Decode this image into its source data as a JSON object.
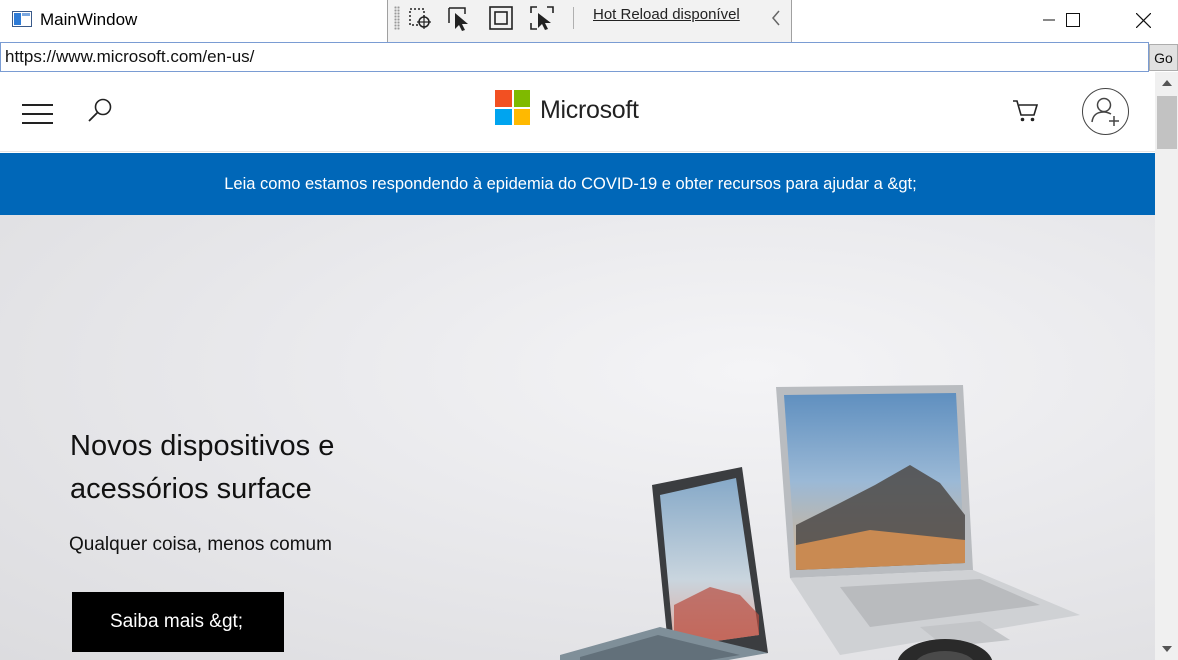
{
  "window": {
    "title": "MainWindow",
    "icon": "app-window-icon",
    "controls": [
      "minimize-icon",
      "maximize-icon",
      "close-icon"
    ]
  },
  "hot_reload_toolbar": {
    "tools": [
      "select-element-icon",
      "pointer-icon",
      "layout-adorner-icon",
      "track-focus-icon"
    ],
    "label": "Hot Reload disponível",
    "collapse_icon": "chevron-left-icon"
  },
  "address_bar": {
    "url": "https://www.microsoft.com/en-us/",
    "go_label": "Go"
  },
  "site_header": {
    "menu_icon": "hamburger-menu-icon",
    "search_icon": "search-icon",
    "logo_text": "Microsoft",
    "cart_icon": "cart-icon",
    "account_icon": "account-add-icon"
  },
  "banner": {
    "text": "Leia como estamos respondendo à epidemia do COVID-19 e obter recursos para ajudar a &gt;"
  },
  "hero": {
    "title": "Novos dispositivos e acessórios surface",
    "subtitle": "Qualquer coisa, menos comum",
    "cta_label": "Saiba mais &gt;"
  },
  "colors": {
    "banner_bg": "#0067b8",
    "cta_bg": "#000000",
    "logo": [
      "#f25022",
      "#7fba00",
      "#00a4ef",
      "#ffb900"
    ]
  }
}
